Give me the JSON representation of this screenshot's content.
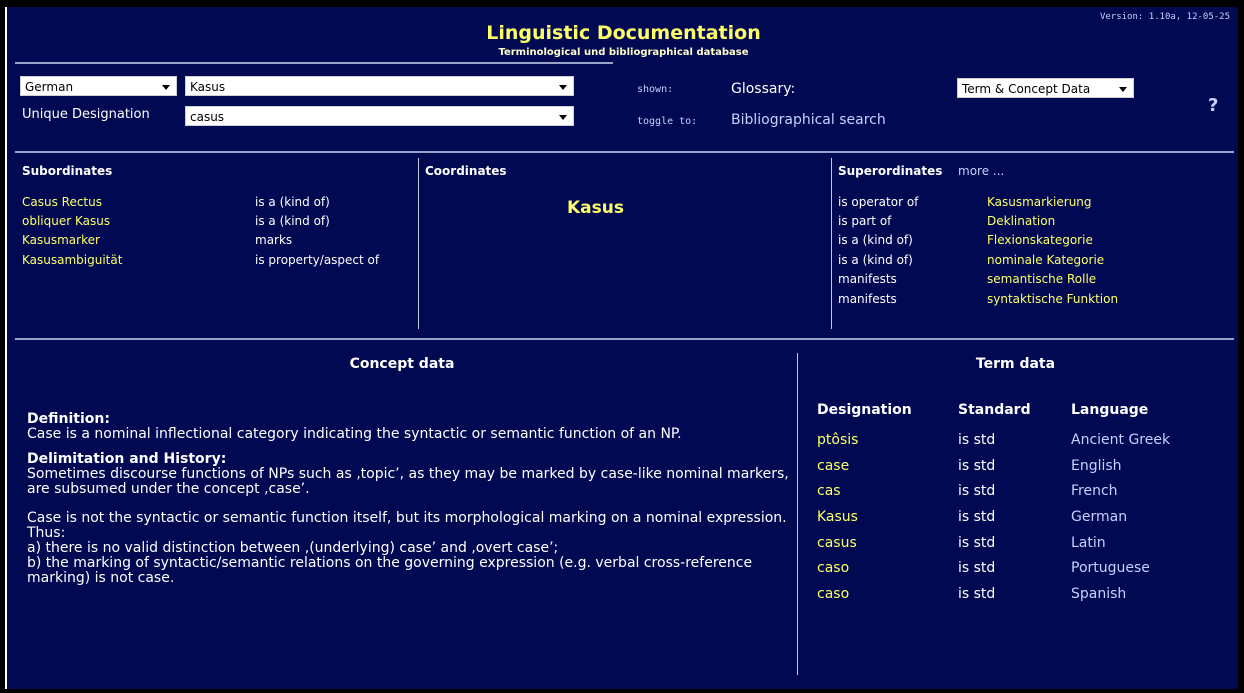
{
  "header": {
    "title": "Linguistic Documentation",
    "subtitle": "Terminological und bibliographical database",
    "version": "Version: 1.10a, 12-05-25"
  },
  "controls": {
    "language_select": "German",
    "term_select": "Kasus",
    "unique_label": "Unique Designation",
    "unique_select": "casus",
    "shown_label": "shown:",
    "shown_value": "Glossary:",
    "toggle_label": "toggle to:",
    "toggle_value": "Bibliographical search",
    "data_select": "Term & Concept Data",
    "help": "?"
  },
  "subordinates": {
    "heading": "Subordinates",
    "items": [
      {
        "term": "Casus Rectus",
        "relation": "is a (kind of)"
      },
      {
        "term": "obliquer Kasus",
        "relation": "is a (kind of)"
      },
      {
        "term": "Kasusmarker",
        "relation": "marks"
      },
      {
        "term": "Kasusambiguität",
        "relation": "is property/aspect of"
      }
    ]
  },
  "coordinates": {
    "heading": "Coordinates",
    "center_term": "Kasus"
  },
  "superordinates": {
    "heading": "Superordinates",
    "more": "more ...",
    "items": [
      {
        "relation": "is operator of",
        "term": "Kasusmarkierung"
      },
      {
        "relation": "is part of",
        "term": "Deklination"
      },
      {
        "relation": "is a (kind of)",
        "term": "Flexionskategorie"
      },
      {
        "relation": "is a (kind of)",
        "term": "nominale Kategorie"
      },
      {
        "relation": "manifests",
        "term": "semantische Rolle"
      },
      {
        "relation": "manifests",
        "term": "syntaktische Funktion"
      }
    ]
  },
  "concept": {
    "heading": "Concept data",
    "definition_label": "Definition:",
    "definition_text": "Case is a nominal inflectional category indicating the syntactic or semantic function of an NP.",
    "delimitation_label": "Delimitation and History:",
    "delimitation_p1": "Sometimes discourse functions of NPs such as ‚topic’, as they may be marked by case-like nominal markers, are subsumed under the concept ‚case’.",
    "delimitation_p2_l1": "Case is not the syntactic or semantic function itself, but its morphological marking on a nominal expression. Thus:",
    "delimitation_p2_l2": "a) there is no valid distinction between ‚(underlying) case’ and ‚overt case’;",
    "delimitation_p2_l3": "b) the marking of syntactic/semantic relations on the governing expression (e.g. verbal cross-reference marking) is not case."
  },
  "termdata": {
    "heading": "Term data",
    "columns": [
      "Designation",
      "Standard",
      "Language"
    ],
    "rows": [
      {
        "designation": "ptôsis",
        "standard": "is std",
        "language": "Ancient Greek"
      },
      {
        "designation": "case",
        "standard": "is std",
        "language": "English"
      },
      {
        "designation": "cas",
        "standard": "is std",
        "language": "French"
      },
      {
        "designation": "Kasus",
        "standard": "is std",
        "language": "German"
      },
      {
        "designation": "casus",
        "standard": "is std",
        "language": "Latin"
      },
      {
        "designation": "caso",
        "standard": "is std",
        "language": "Portuguese"
      },
      {
        "designation": "caso",
        "standard": "is std",
        "language": "Spanish"
      }
    ]
  },
  "colors": {
    "background": "#000952",
    "link": "#ffff66",
    "text": "#ffffff"
  }
}
